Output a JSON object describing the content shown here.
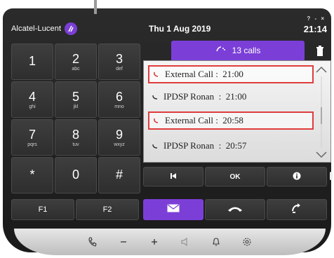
{
  "brand": {
    "name": "Alcatel-Lucent",
    "logo_icon": "alcatel-lucent-logo-icon"
  },
  "header": {
    "date": "Thu 1 Aug 2019",
    "time": "21:14",
    "window_controls": "? - ×"
  },
  "keypad": [
    {
      "digit": "1",
      "letters": ""
    },
    {
      "digit": "2",
      "letters": "abc"
    },
    {
      "digit": "3",
      "letters": "def"
    },
    {
      "digit": "4",
      "letters": "ghi"
    },
    {
      "digit": "5",
      "letters": "jkl"
    },
    {
      "digit": "6",
      "letters": "mno"
    },
    {
      "digit": "7",
      "letters": "pqrs"
    },
    {
      "digit": "8",
      "letters": "tuv"
    },
    {
      "digit": "9",
      "letters": "wxyz"
    },
    {
      "digit": "*",
      "letters": ""
    },
    {
      "digit": "0",
      "letters": ""
    },
    {
      "digit": "#",
      "letters": ""
    }
  ],
  "function_keys": [
    "F1",
    "F2"
  ],
  "calls_tab": {
    "label": "13 calls",
    "icon": "missed-calls-icon"
  },
  "call_list": [
    {
      "label": "External Call :  21:00",
      "type": "missed",
      "highlighted": true
    },
    {
      "label": "IPDSP Ronan  :  21:00",
      "type": "incoming",
      "highlighted": false
    },
    {
      "label": "External Call :  20:58",
      "type": "missed",
      "highlighted": true
    },
    {
      "label": "IPDSP Ronan  :  20:57",
      "type": "incoming",
      "highlighted": false
    }
  ],
  "controls": {
    "first_icon": "skip-first-icon",
    "ok_label": "OK",
    "info_icon": "info-icon"
  },
  "actions": [
    {
      "name": "mail",
      "icon": "envelope-icon"
    },
    {
      "name": "hangup",
      "icon": "hangup-icon"
    },
    {
      "name": "redirect",
      "icon": "redirect-call-icon"
    }
  ],
  "bottom_bar_icons": [
    "handset-icon",
    "volume-minus-icon",
    "volume-plus-icon",
    "speaker-icon",
    "bell-icon",
    "settings-icon"
  ],
  "colors": {
    "accent": "#7b3fd8",
    "highlight_border": "#e03c3c",
    "bezel": "#222222"
  }
}
